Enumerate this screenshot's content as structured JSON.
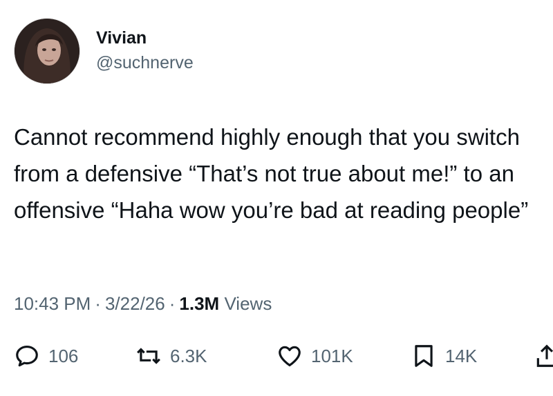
{
  "author": {
    "display_name": "Vivian",
    "handle": "@suchnerve"
  },
  "tweet": {
    "text": "Cannot recommend highly enough that you switch from a defensive “That’s not true about me!” to an offensive “Haha wow you’re bad at reading people”"
  },
  "meta": {
    "time": "10:43 PM",
    "separator": "·",
    "date": "3/22/26",
    "views_count": "1.3M",
    "views_label": "Views"
  },
  "actions": {
    "replies": {
      "icon": "reply-icon",
      "count": "106"
    },
    "retweets": {
      "icon": "retweet-icon",
      "count": "6.3K"
    },
    "likes": {
      "icon": "like-icon",
      "count": "101K"
    },
    "bookmarks": {
      "icon": "bookmark-icon",
      "count": "14K"
    },
    "share": {
      "icon": "share-icon"
    }
  },
  "colors": {
    "text": "#0f1419",
    "secondary": "#536471",
    "background": "#ffffff"
  }
}
